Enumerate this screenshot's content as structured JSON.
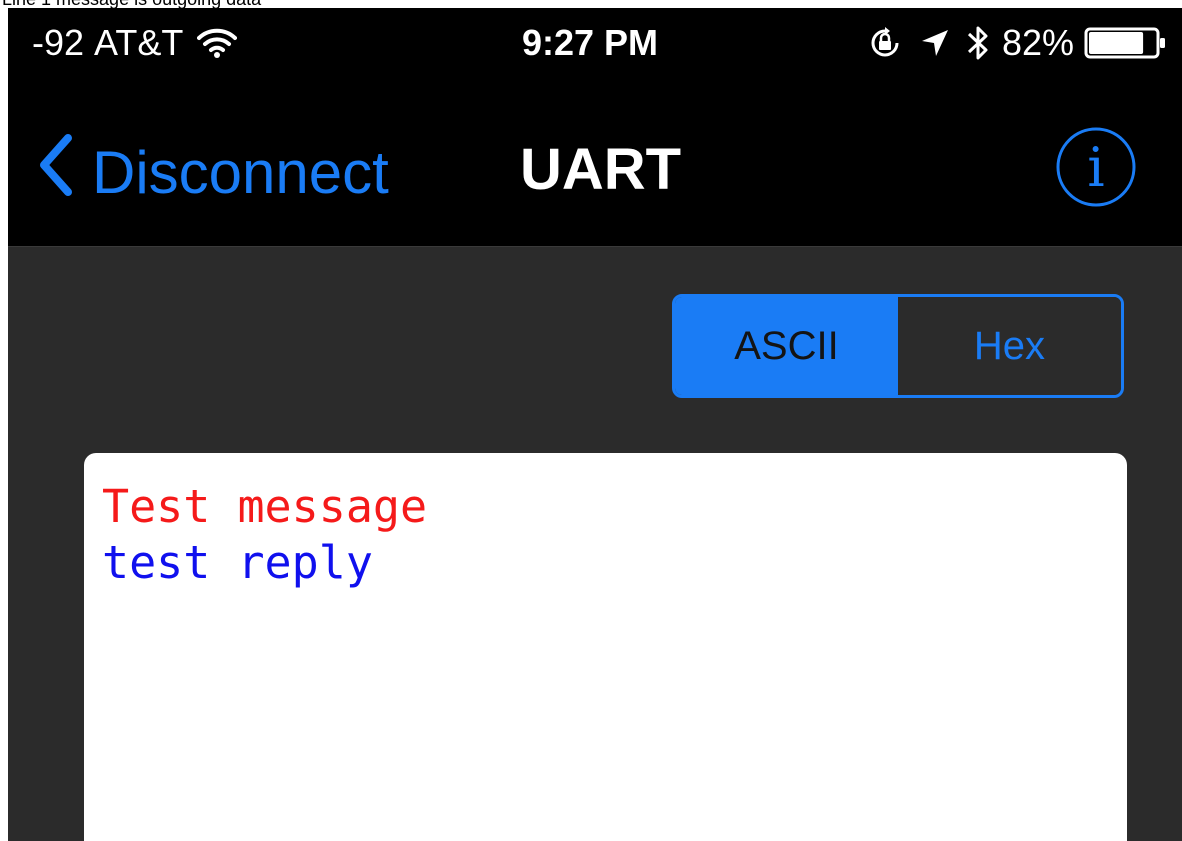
{
  "caption": "Line 1 message is outgoing data",
  "status": {
    "signal": "-92",
    "carrier": "AT&T",
    "time": "9:27 PM",
    "battery": "82%",
    "battery_level": 0.82
  },
  "nav": {
    "back_label": "Disconnect",
    "title": "UART",
    "info_label": "i"
  },
  "segmented": {
    "options": [
      "ASCII",
      "Hex"
    ],
    "selected": "ASCII"
  },
  "console": {
    "lines": [
      {
        "text": "Test message",
        "direction": "outgoing"
      },
      {
        "text": "test reply",
        "direction": "incoming"
      }
    ]
  },
  "colors": {
    "accent": "#1a7cf5",
    "outgoing": "#f51a1a",
    "incoming": "#1010ee",
    "background": "#2b2b2b"
  }
}
